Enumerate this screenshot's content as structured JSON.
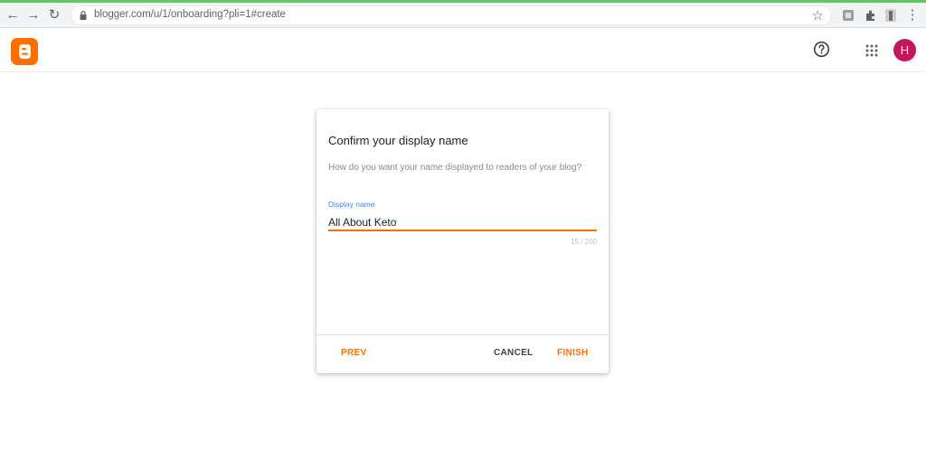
{
  "browser": {
    "url": "blogger.com/u/1/onboarding?pli=1#create",
    "back_icon": "←",
    "forward_icon": "→",
    "reload_icon": "↻",
    "star_icon": "☆",
    "menu_icon": "⋮"
  },
  "header": {
    "avatar_initial": "H",
    "colors": {
      "brand": "#ff6f00",
      "avatar": "#c2185b"
    }
  },
  "dialog": {
    "title": "Confirm your display name",
    "description": "How do you want your name displayed to readers of your blog?",
    "field_label": "Display name",
    "field_value": "All About Keto",
    "counter": "15 / 200",
    "prev_label": "PREV",
    "cancel_label": "CANCEL",
    "finish_label": "FINISH"
  }
}
